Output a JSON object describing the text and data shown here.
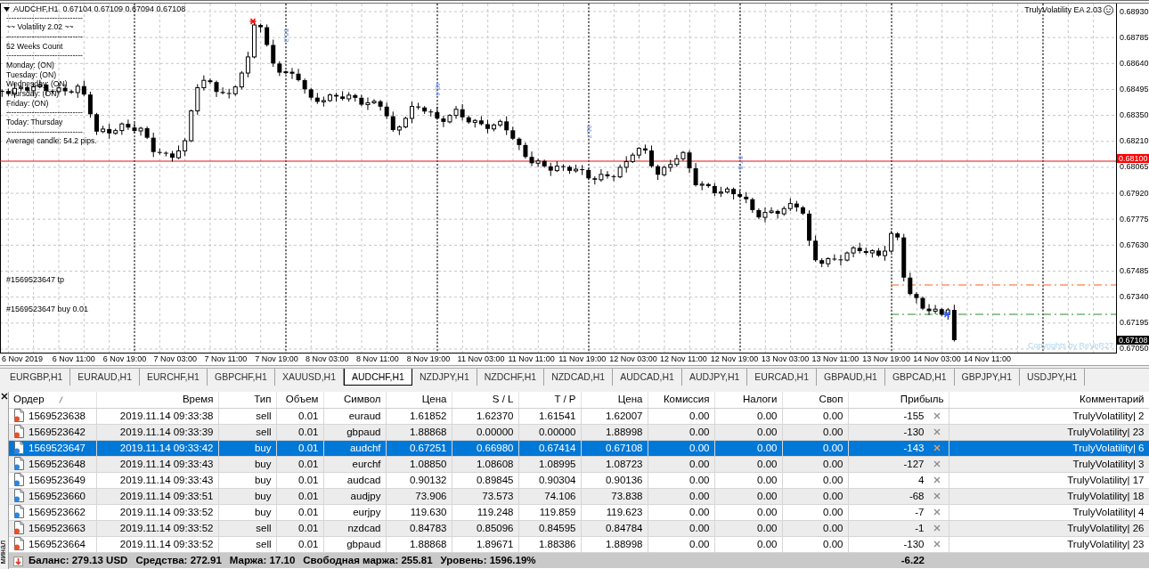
{
  "chart": {
    "header": {
      "symbol": "AUDCHF,H1",
      "quotes": "0.67104 0.67109 0.67094 0.67108"
    },
    "info_panel": [
      "------------------------------",
      "~~ Volatility 2.02 ~~",
      "------------------------------",
      "52 Weeks Count",
      "------------------------------",
      "Monday: (ON)",
      "Tuesday: (ON)",
      "Wednesday: (ON)",
      "Thursday: (ON)",
      "Friday: (ON)",
      "------------------------------",
      "Today: Thursday",
      "------------------------------",
      "Average candle: 54.2 pips."
    ],
    "ea_label": "TrulyVolatility EA 2.03",
    "copyright": "Copyrights by ReVeR27",
    "day_ranges": [
      "56.3",
      "48.4",
      "31.7",
      "57.6"
    ],
    "order_lines": [
      {
        "label": "#1569523647 tp",
        "kind": "tp"
      },
      {
        "label": "#1569523647 buy 0.01",
        "kind": "open"
      }
    ],
    "price_axis": [
      "0.68930",
      "0.68785",
      "0.68640",
      "0.68495",
      "0.68350",
      "0.68210",
      "0.68065",
      "0.67920",
      "0.67775",
      "0.67630",
      "0.67485",
      "0.67340",
      "0.67195",
      "0.67050"
    ],
    "price_markers": [
      {
        "label": "0.68100",
        "kind": "line"
      },
      {
        "label": "0.67108",
        "kind": "bid"
      }
    ],
    "time_axis": [
      "6 Nov 2019",
      "6 Nov 11:00",
      "6 Nov 19:00",
      "7 Nov 03:00",
      "7 Nov 11:00",
      "7 Nov 19:00",
      "8 Nov 03:00",
      "8 Nov 11:00",
      "8 Nov 19:00",
      "11 Nov 03:00",
      "11 Nov 11:00",
      "11 Nov 19:00",
      "12 Nov 03:00",
      "12 Nov 11:00",
      "12 Nov 19:00",
      "13 Nov 03:00",
      "13 Nov 11:00",
      "13 Nov 19:00",
      "14 Nov 03:00",
      "14 Nov 11:00"
    ]
  },
  "chart_tabs": [
    {
      "label": "EURGBP,H1",
      "selected": false
    },
    {
      "label": "EURAUD,H1",
      "selected": false
    },
    {
      "label": "EURCHF,H1",
      "selected": false
    },
    {
      "label": "GBPCHF,H1",
      "selected": false
    },
    {
      "label": "XAUUSD,H1",
      "selected": false
    },
    {
      "label": "AUDCHF,H1",
      "selected": true
    },
    {
      "label": "NZDJPY,H1",
      "selected": false
    },
    {
      "label": "NZDCHF,H1",
      "selected": false
    },
    {
      "label": "NZDCAD,H1",
      "selected": false
    },
    {
      "label": "AUDCAD,H1",
      "selected": false
    },
    {
      "label": "AUDJPY,H1",
      "selected": false
    },
    {
      "label": "EURCAD,H1",
      "selected": false
    },
    {
      "label": "GBPAUD,H1",
      "selected": false
    },
    {
      "label": "GBPCAD,H1",
      "selected": false
    },
    {
      "label": "GBPJPY,H1",
      "selected": false
    },
    {
      "label": "USDJPY,H1",
      "selected": false
    }
  ],
  "terminal": {
    "side_title": "минал",
    "columns": [
      {
        "label": "Ордер",
        "sorted": true
      },
      {
        "label": "Время",
        "sorted": false
      },
      {
        "label": "Тип",
        "sorted": false
      },
      {
        "label": "Объем",
        "sorted": false
      },
      {
        "label": "Символ",
        "sorted": false
      },
      {
        "label": "Цена",
        "sorted": false
      },
      {
        "label": "S / L",
        "sorted": false
      },
      {
        "label": "T / P",
        "sorted": false
      },
      {
        "label": "Цена",
        "sorted": false
      },
      {
        "label": "Комиссия",
        "sorted": false
      },
      {
        "label": "Налоги",
        "sorted": false
      },
      {
        "label": "Своп",
        "sorted": false
      },
      {
        "label": "Прибыль",
        "sorted": false
      },
      {
        "label": "Комментарий",
        "sorted": false
      }
    ],
    "rows": [
      {
        "kind": "sell",
        "selected": false,
        "cells": [
          "1569523638",
          "2019.11.14 09:33:38",
          "sell",
          "0.01",
          "euraud",
          "1.61852",
          "1.62370",
          "1.61541",
          "1.62007",
          "0.00",
          "0.00",
          "0.00",
          "-155",
          "TrulyVolatility| 2"
        ]
      },
      {
        "kind": "sell",
        "selected": false,
        "cells": [
          "1569523642",
          "2019.11.14 09:33:39",
          "sell",
          "0.01",
          "gbpaud",
          "1.88868",
          "0.00000",
          "0.00000",
          "1.88998",
          "0.00",
          "0.00",
          "0.00",
          "-130",
          "TrulyVolatility| 23"
        ]
      },
      {
        "kind": "buy",
        "selected": true,
        "cells": [
          "1569523647",
          "2019.11.14 09:33:42",
          "buy",
          "0.01",
          "audchf",
          "0.67251",
          "0.66980",
          "0.67414",
          "0.67108",
          "0.00",
          "0.00",
          "0.00",
          "-143",
          "TrulyVolatility| 6"
        ]
      },
      {
        "kind": "buy",
        "selected": false,
        "cells": [
          "1569523648",
          "2019.11.14 09:33:43",
          "buy",
          "0.01",
          "eurchf",
          "1.08850",
          "1.08608",
          "1.08995",
          "1.08723",
          "0.00",
          "0.00",
          "0.00",
          "-127",
          "TrulyVolatility| 3"
        ]
      },
      {
        "kind": "buy",
        "selected": false,
        "cells": [
          "1569523649",
          "2019.11.14 09:33:43",
          "buy",
          "0.01",
          "audcad",
          "0.90132",
          "0.89845",
          "0.90304",
          "0.90136",
          "0.00",
          "0.00",
          "0.00",
          "4",
          "TrulyVolatility| 17"
        ]
      },
      {
        "kind": "buy",
        "selected": false,
        "cells": [
          "1569523660",
          "2019.11.14 09:33:51",
          "buy",
          "0.01",
          "audjpy",
          "73.906",
          "73.573",
          "74.106",
          "73.838",
          "0.00",
          "0.00",
          "0.00",
          "-68",
          "TrulyVolatility| 18"
        ]
      },
      {
        "kind": "buy",
        "selected": false,
        "cells": [
          "1569523662",
          "2019.11.14 09:33:52",
          "buy",
          "0.01",
          "eurjpy",
          "119.630",
          "119.248",
          "119.859",
          "119.623",
          "0.00",
          "0.00",
          "0.00",
          "-7",
          "TrulyVolatility| 4"
        ]
      },
      {
        "kind": "sell",
        "selected": false,
        "cells": [
          "1569523663",
          "2019.11.14 09:33:52",
          "sell",
          "0.01",
          "nzdcad",
          "0.84783",
          "0.85096",
          "0.84595",
          "0.84784",
          "0.00",
          "0.00",
          "0.00",
          "-1",
          "TrulyVolatility| 26"
        ]
      },
      {
        "kind": "sell",
        "selected": false,
        "cells": [
          "1569523664",
          "2019.11.14 09:33:52",
          "sell",
          "0.01",
          "gbpaud",
          "1.88868",
          "1.89671",
          "1.88386",
          "1.88998",
          "0.00",
          "0.00",
          "0.00",
          "-130",
          "TrulyVolatility| 23"
        ]
      }
    ],
    "summary": {
      "items": [
        "Баланс: 279.13 USD",
        "Средства: 272.91",
        "Маржа: 17.10",
        "Свободная маржа: 255.81",
        "Уровень: 1596.19%"
      ],
      "profit": "-6.22"
    }
  }
}
